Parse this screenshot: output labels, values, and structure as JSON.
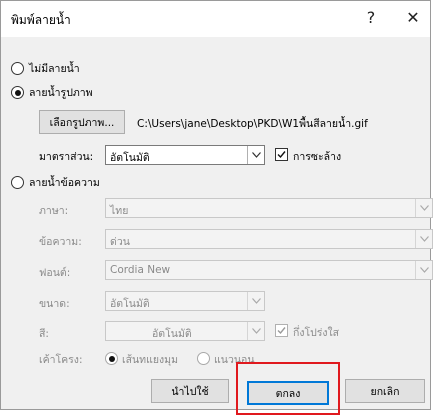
{
  "dialog": {
    "title": "พิมพ์ลายน้ำ",
    "help_label": "?",
    "close_label": "✕"
  },
  "no_watermark": {
    "label": "ไม่มีลายน้ำ",
    "selected": false
  },
  "picture_watermark": {
    "label": "ลายน้ำรูปภาพ",
    "selected": true,
    "select_picture_button": "เลือกรูปภาพ...",
    "file_path": "C:\\Users\\jane\\Desktop\\PKD\\W1พื้นสีลายน้ำ.gif",
    "scale_label": "มาตราส่วน:",
    "scale_value": "อัตโนมัติ",
    "washout_label": "การซะล้าง",
    "washout_checked": true
  },
  "text_watermark": {
    "label": "ลายน้ำข้อความ",
    "selected": false,
    "language_label": "ภาษา:",
    "language_value": "ไทย",
    "text_label": "ข้อความ:",
    "text_value": "ด่วน",
    "font_label": "ฟอนต์:",
    "font_value": "Cordia New",
    "size_label": "ขนาด:",
    "size_value": "อัตโนมัติ",
    "color_label": "สี:",
    "color_value": "อัตโนมัติ",
    "semitransparent_label": "กึ่งโปร่งใส",
    "semitransparent_checked": true,
    "layout_label": "เค้าโครง:",
    "layout_diagonal": "เส้นทแยงมุม",
    "layout_horizontal": "แนวนอน",
    "layout_selected": "diagonal"
  },
  "buttons": {
    "apply": "นำไปใช้",
    "ok": "ตกลง",
    "cancel": "ยกเลิก"
  },
  "background_fragments": [
    "ต",
    "ใ",
    "ด"
  ],
  "colors": {
    "dialog_bg": "#f0f0f0",
    "highlight": "#e0191e",
    "accent": "#0078d7"
  }
}
